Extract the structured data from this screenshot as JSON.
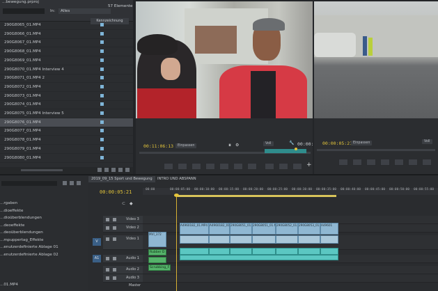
{
  "project_panel": {
    "file_name": "...bewegung.prproj",
    "count_label": "57 Elemente",
    "in_label": "In:",
    "in_value": "Alles",
    "column_header": "Kennzeichnung",
    "clips": [
      {
        "name": "290G8065_01.MP4",
        "selected": false
      },
      {
        "name": "290G8066_01.MP4",
        "selected": false
      },
      {
        "name": "290G8067_01.MP4",
        "selected": false
      },
      {
        "name": "290G8068_01.MP4",
        "selected": false
      },
      {
        "name": "290G8069_01.MP4",
        "selected": false
      },
      {
        "name": "290G8070_01.MP4 Interview 4",
        "selected": false
      },
      {
        "name": "290G8071_01.MP4 2",
        "selected": false
      },
      {
        "name": "290G8072_01.MP4",
        "selected": false
      },
      {
        "name": "290G8073_01.MP4",
        "selected": false
      },
      {
        "name": "290G8074_01.MP4",
        "selected": false
      },
      {
        "name": "290G8075_01.MP4 Interview 5",
        "selected": false
      },
      {
        "name": "290G8076_01.MP4",
        "selected": true
      },
      {
        "name": "290G8077_01.MP4",
        "selected": false
      },
      {
        "name": "290G8078_01.MP4",
        "selected": false
      },
      {
        "name": "290G8079_01.MP4",
        "selected": false
      },
      {
        "name": "290G8080_01.MP4",
        "selected": false
      }
    ]
  },
  "source_monitor": {
    "timecode_in": "00:11:06:13",
    "fit_dropdown": "Einpassen",
    "quality_dropdown": "Voll",
    "timecode_out": "00:00:20:18"
  },
  "program_monitor": {
    "timecode_in": "00:00:05:21",
    "fit_dropdown": "Einpassen",
    "quality_dropdown": "Voll"
  },
  "effects_panel": {
    "items": [
      "...rgaben",
      "...dioeffekte",
      "...dioüberblendungen",
      "...deoeffekte",
      "...deoüberblendungen",
      "...mpuppertag_Effekte",
      "...enutzerdefinierte Ablage 01",
      "...enutzerdefinierte Ablage 02"
    ],
    "bottom_item": "...01.MP4"
  },
  "timeline": {
    "tabs": [
      "2019_09_15 Sport und Bewegung",
      "INTRO UND ABSPANN"
    ],
    "timecode": "00:00:05:21",
    "ruler_ticks": [
      "00:00",
      "00:00:05:00",
      "00:00:10:00",
      "00:00:15:00",
      "00:00:20:00",
      "00:00:25:00",
      "00:00:30:00",
      "00:00:35:00",
      "00:00:40:00",
      "00:00:45:00",
      "00:00:50:00",
      "00:00:55:00"
    ],
    "tracks": [
      {
        "label": "Video 3"
      },
      {
        "label": "Video 2"
      },
      {
        "label": "Video 1",
        "side": "V"
      },
      {
        "label": "Audio 1",
        "side": "A1"
      },
      {
        "label": "Audio 2"
      },
      {
        "label": "Audio 3"
      }
    ],
    "master_label": "Master",
    "video_clip_labels": [
      "MVI_372",
      "A4960182_01.MP4",
      "A4960182_01",
      "290G8051_01.MP4",
      "290G8051_01.MP4",
      "290G8052_01.MP4",
      "290G8053_01.MP4",
      "A49601"
    ],
    "graphic_clips": [
      "Rubber D",
      "Scrubbing_F"
    ]
  }
}
